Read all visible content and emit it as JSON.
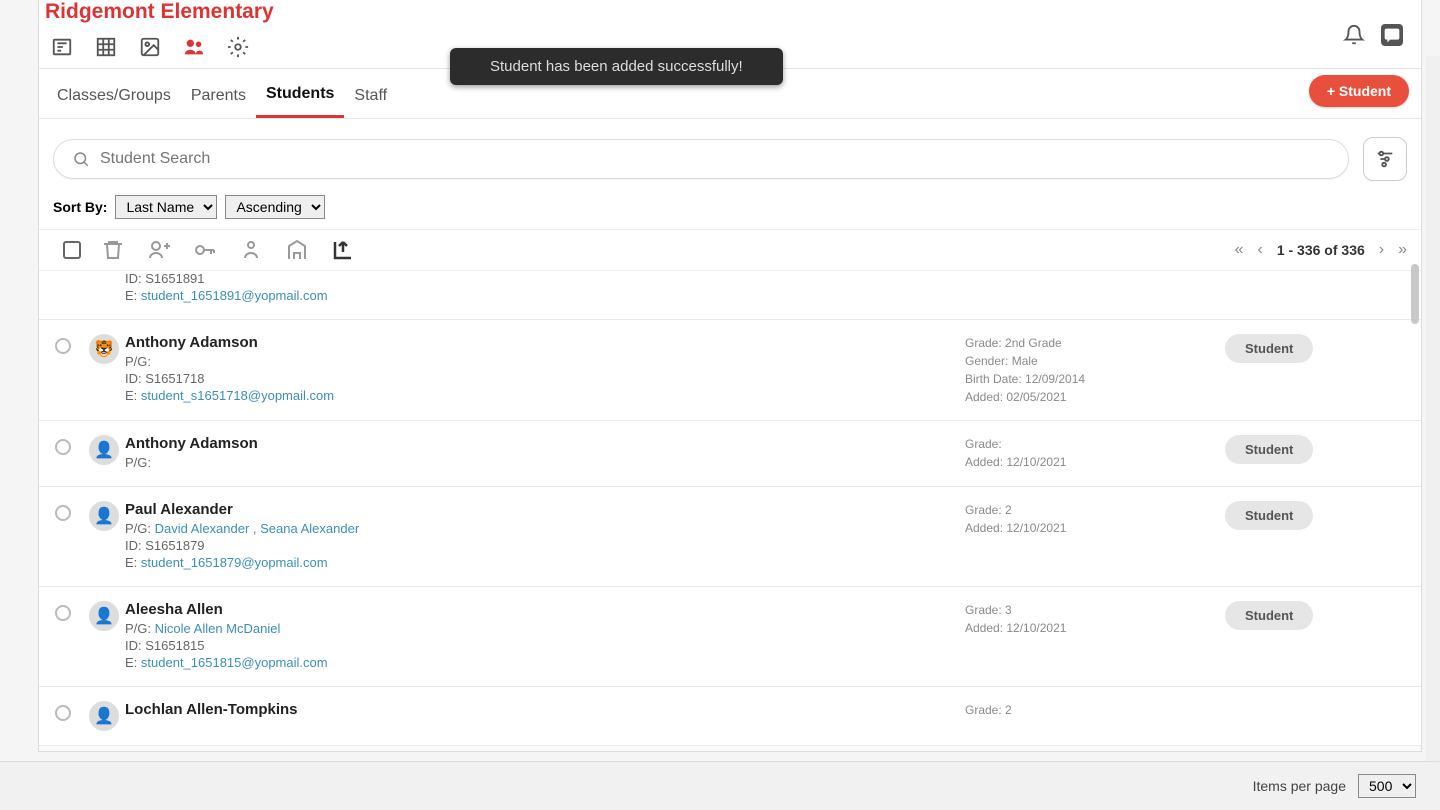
{
  "school_name": "Ridgemont Elementary",
  "toast": "Student has been added successfully!",
  "tabs": {
    "classes": "Classes/Groups",
    "parents": "Parents",
    "students": "Students",
    "staff": "Staff"
  },
  "add_button": "+ Student",
  "search": {
    "placeholder": "Student Search"
  },
  "sort": {
    "label": "Sort By:",
    "field": "Last Name",
    "order": "Ascending"
  },
  "pager": {
    "range": "1 - 336 of 336"
  },
  "rows": [
    {
      "partial": true,
      "avatar": "",
      "name": "",
      "pg_label": "",
      "pg": "",
      "id_label": "ID:",
      "id": "S1651891",
      "e_label": "E:",
      "email": "student_1651891@yopmail.com",
      "meta": [],
      "role": ""
    },
    {
      "avatar": "🐯",
      "name": "Anthony Adamson",
      "pg_label": "P/G:",
      "pg": "",
      "id_label": "ID:",
      "id": "S1651718",
      "e_label": "E:",
      "email": "student_s1651718@yopmail.com",
      "meta": [
        "Grade: 2nd Grade",
        "Gender: Male",
        "Birth Date: 12/09/2014",
        "Added: 02/05/2021"
      ],
      "role": "Student"
    },
    {
      "avatar": "👤",
      "name": "Anthony Adamson",
      "pg_label": "P/G:",
      "pg": "",
      "id_label": "",
      "id": "",
      "e_label": "",
      "email": "",
      "meta": [
        "Grade:",
        "Added: 12/10/2021"
      ],
      "role": "Student"
    },
    {
      "avatar": "👤",
      "name": "Paul Alexander",
      "pg_label": "P/G:",
      "pg": "David Alexander , Seana Alexander",
      "id_label": "ID:",
      "id": "S1651879",
      "e_label": "E:",
      "email": "student_1651879@yopmail.com",
      "meta": [
        "Grade: 2",
        "Added: 12/10/2021"
      ],
      "role": "Student"
    },
    {
      "avatar": "👤",
      "name": "Aleesha Allen",
      "pg_label": "P/G:",
      "pg": "Nicole Allen McDaniel",
      "id_label": "ID:",
      "id": "S1651815",
      "e_label": "E:",
      "email": "student_1651815@yopmail.com",
      "meta": [
        "Grade: 3",
        "Added: 12/10/2021"
      ],
      "role": "Student"
    },
    {
      "avatar": "👤",
      "name": "Lochlan Allen-Tompkins",
      "pg_label": "",
      "pg": "",
      "id_label": "",
      "id": "",
      "e_label": "",
      "email": "",
      "meta": [
        "Grade: 2"
      ],
      "role": ""
    }
  ],
  "footer": {
    "label": "Items per page",
    "value": "500"
  }
}
